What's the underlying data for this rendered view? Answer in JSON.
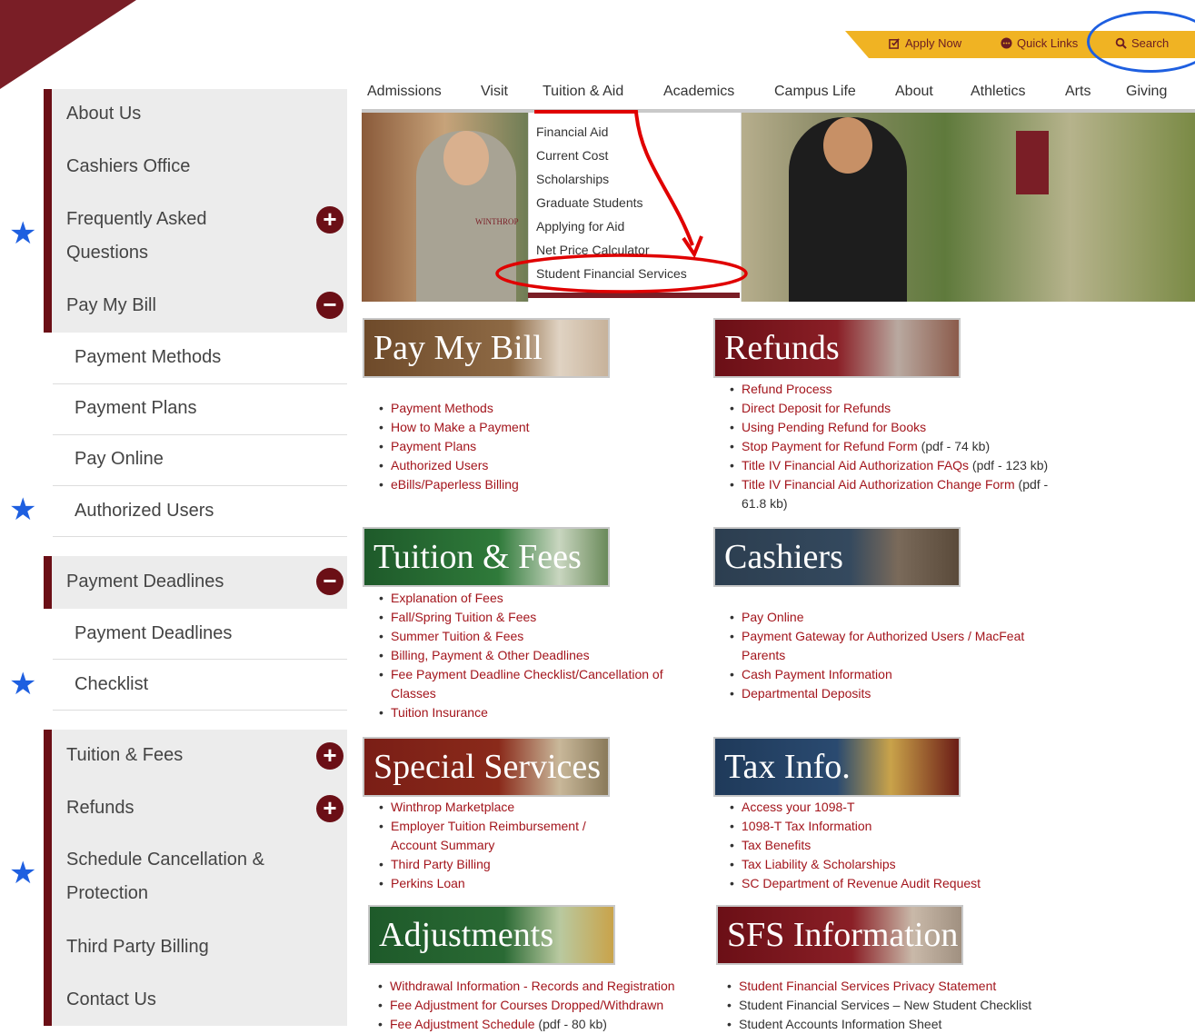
{
  "utility": {
    "apply": "Apply Now",
    "quick": "Quick Links",
    "search": "Search"
  },
  "nav": [
    "Admissions",
    "Visit",
    "Tuition & Aid",
    "Academics",
    "Campus Life",
    "About",
    "Athletics",
    "Arts",
    "Giving"
  ],
  "dropdown": [
    "Financial Aid",
    "Current Cost",
    "Scholarships",
    "Graduate Students",
    "Applying for Aid",
    "Net Price Calculator",
    "Student Financial Services"
  ],
  "hero": {
    "shirt_text": "WINTHROP"
  },
  "sidebar": [
    {
      "label": "About Us",
      "type": "top",
      "toggle": ""
    },
    {
      "label": "Cashiers Office",
      "type": "top",
      "toggle": ""
    },
    {
      "label": "Frequently Asked Questions",
      "type": "top",
      "toggle": "+"
    },
    {
      "label": "Pay My Bill",
      "type": "top",
      "toggle": "−"
    },
    {
      "label": "Payment Methods",
      "type": "sub"
    },
    {
      "label": "Payment Plans",
      "type": "sub"
    },
    {
      "label": "Pay Online",
      "type": "sub"
    },
    {
      "label": "Authorized Users",
      "type": "sub"
    },
    {
      "label": "Payment Deadlines",
      "type": "top",
      "toggle": "−"
    },
    {
      "label": "Payment Deadlines",
      "type": "sub"
    },
    {
      "label": "Checklist",
      "type": "sub"
    },
    {
      "label": "Tuition & Fees",
      "type": "top",
      "toggle": "+"
    },
    {
      "label": "Refunds",
      "type": "top",
      "toggle": "+"
    },
    {
      "label": "Schedule Cancellation & Protection",
      "type": "top",
      "toggle": ""
    },
    {
      "label": "Third Party Billing",
      "type": "top",
      "toggle": ""
    },
    {
      "label": "Contact Us",
      "type": "top",
      "toggle": ""
    }
  ],
  "sections": {
    "paymybill": {
      "title": "Pay My Bill",
      "items": [
        "Payment Methods",
        "How to Make a Payment",
        "Payment Plans",
        "Authorized Users",
        "eBills/Paperless Billing"
      ]
    },
    "refunds": {
      "title": "Refunds",
      "items": [
        {
          "link": "Refund Process",
          "note": ""
        },
        {
          "link": "Direct Deposit for Refunds",
          "note": ""
        },
        {
          "link": "Using Pending Refund for Books",
          "note": ""
        },
        {
          "link": "Stop Payment for Refund Form",
          "note": " (pdf - 74 kb)"
        },
        {
          "link": "Title IV Financial Aid Authorization FAQs",
          "note": " (pdf - 123 kb)"
        },
        {
          "link": "Title IV Financial Aid Authorization Change Form",
          "note": " (pdf - 61.8 kb)"
        }
      ]
    },
    "tuition": {
      "title": "Tuition & Fees",
      "items": [
        "Explanation of Fees",
        "Fall/Spring Tuition & Fees",
        "Summer Tuition & Fees",
        "Billing, Payment & Other Deadlines",
        "Fee Payment Deadline Checklist/Cancellation of Classes",
        "Tuition Insurance"
      ]
    },
    "cashiers": {
      "title": "Cashiers",
      "items": [
        "Pay Online",
        "Payment Gateway for Authorized Users / MacFeat Parents",
        "Cash Payment Information",
        "Departmental Deposits"
      ]
    },
    "special": {
      "title": "Special Services",
      "items": [
        "Winthrop Marketplace",
        "Employer Tuition Reimbursement / Account Summary",
        "Third Party Billing",
        "Perkins Loan"
      ]
    },
    "tax": {
      "title": "Tax Info.",
      "items": [
        "Access your 1098-T",
        "1098-T Tax Information",
        "Tax Benefits",
        "Tax Liability & Scholarships",
        "SC Department of Revenue Audit Request"
      ]
    },
    "adjust": {
      "title": "Adjustments",
      "items": [
        {
          "link": "Withdrawal Information - Records and Registration",
          "note": ""
        },
        {
          "link": "Fee Adjustment for Courses Dropped/Withdrawn",
          "note": ""
        },
        {
          "link": "Fee Adjustment Schedule",
          "note": " (pdf - 80 kb)"
        }
      ]
    },
    "sfs": {
      "title": "SFS Information",
      "items": [
        {
          "text": "Student Financial Services Privacy Statement",
          "link": true
        },
        {
          "text": "Student Financial Services – New Student Checklist",
          "link": false
        },
        {
          "text": "Student Accounts Information Sheet",
          "link": false
        }
      ]
    }
  },
  "colors": {
    "maroon": "#6b0f16",
    "gold": "#f0b323",
    "link": "#a3151c",
    "annotation_blue": "#1e5fe0",
    "annotation_red": "#e00000"
  }
}
